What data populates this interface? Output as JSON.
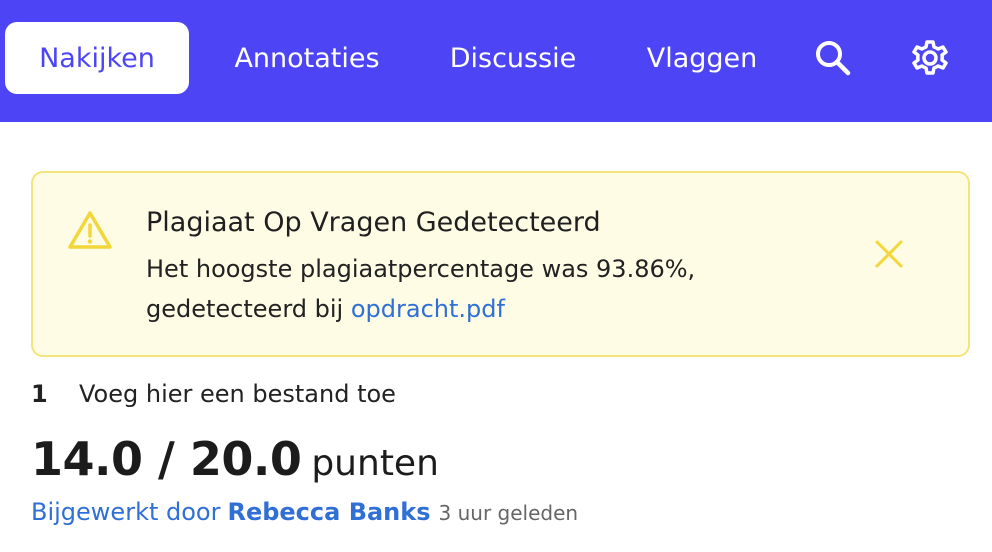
{
  "nav": {
    "tabs": [
      {
        "label": "Nakijken",
        "active": true
      },
      {
        "label": "Annotaties",
        "active": false
      },
      {
        "label": "Discussie",
        "active": false
      },
      {
        "label": "Vlaggen",
        "active": false
      }
    ],
    "icons": [
      "search-icon",
      "gear-icon"
    ],
    "colors": {
      "bar": "#4d45f5",
      "active_tab_bg": "#ffffff",
      "text": "#ffffff"
    }
  },
  "alert": {
    "icon": "warning-icon",
    "title": "Plagiaat Op Vragen Gedetecteerd",
    "body_line1": "Het hoogste plagiaatpercentage was 93.86%,",
    "body_line2_prefix": "gedetecteerd bij",
    "link_text": "opdracht.pdf",
    "close_icon": "close-icon",
    "colors": {
      "background": "#fefce4",
      "border": "#f6e37a",
      "icon": "#f2d63a",
      "link": "#2f6fd6"
    }
  },
  "question": {
    "number": "1",
    "text": "Voeg hier een bestand toe"
  },
  "score": {
    "value": "14.0 / 20.0",
    "unit": "punten"
  },
  "updated": {
    "prefix": "Bijgewerkt door",
    "name": "Rebecca Banks",
    "time": "3 uur geleden"
  }
}
